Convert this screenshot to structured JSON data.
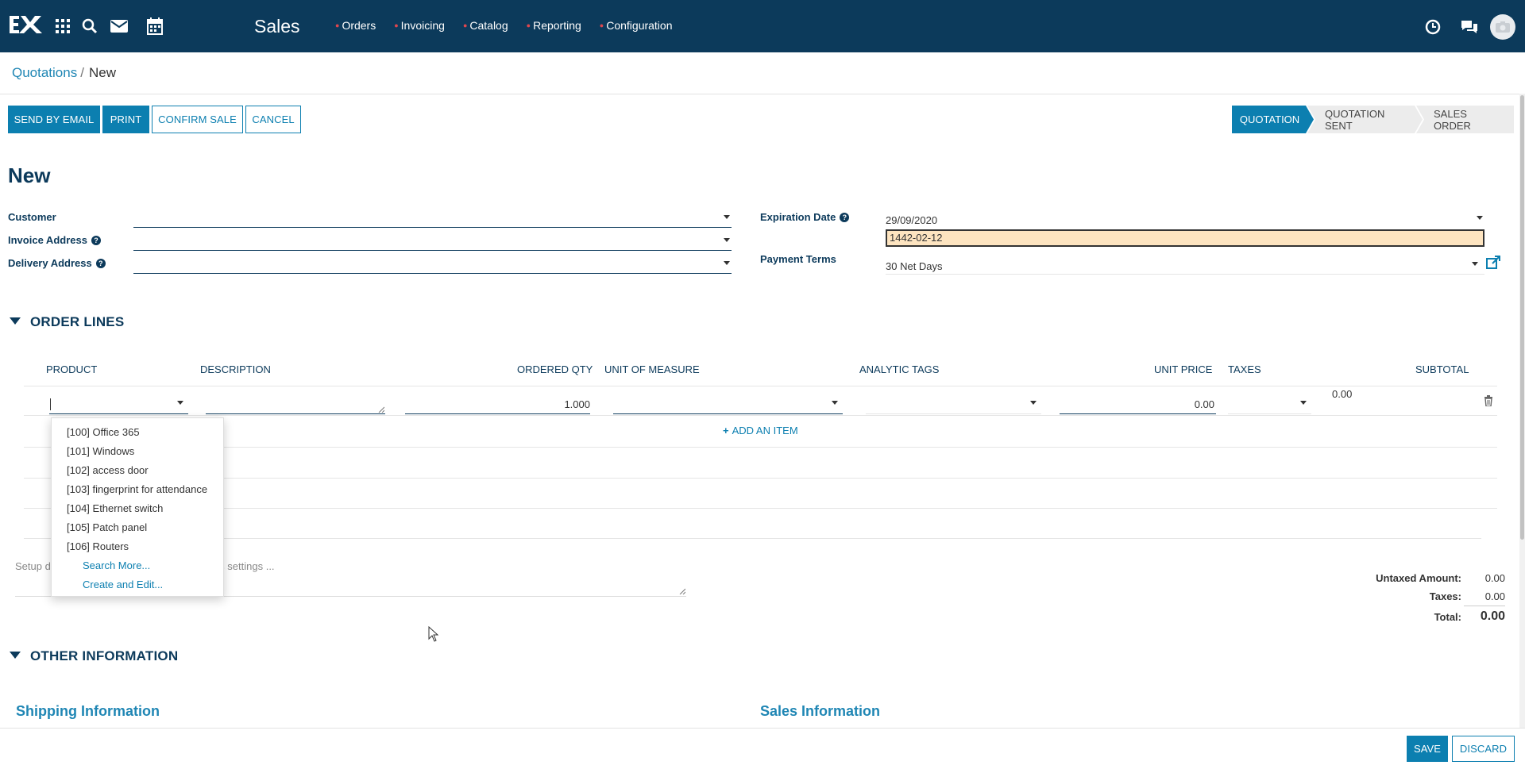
{
  "navbar": {
    "app_title": "Sales",
    "menu": [
      "Orders",
      "Invoicing",
      "Catalog",
      "Reporting",
      "Configuration"
    ]
  },
  "breadcrumb": {
    "parent": "Quotations",
    "separator": "/",
    "current": "New"
  },
  "actions": {
    "send_by_email": "SEND BY EMAIL",
    "print": "PRINT",
    "confirm_sale": "CONFIRM SALE",
    "cancel": "CANCEL"
  },
  "status": [
    "QUOTATION",
    "QUOTATION SENT",
    "SALES ORDER"
  ],
  "record_title": "New",
  "form": {
    "customer_label": "Customer",
    "invoice_address_label": "Invoice Address",
    "delivery_address_label": "Delivery Address",
    "expiration_date_label": "Expiration Date",
    "expiration_date_value": "29/09/2020",
    "expiration_date_hijri": "1442-02-12",
    "payment_terms_label": "Payment Terms",
    "payment_terms_value": "30 Net Days"
  },
  "sections": {
    "order_lines": "ORDER LINES",
    "other_information": "OTHER INFORMATION"
  },
  "table": {
    "headers": {
      "product": "PRODUCT",
      "description": "DESCRIPTION",
      "ordered_qty": "ORDERED QTY",
      "uom": "UNIT OF MEASURE",
      "analytic_tags": "ANALYTIC TAGS",
      "unit_price": "UNIT PRICE",
      "taxes": "TAXES",
      "subtotal": "SUBTOTAL"
    },
    "row": {
      "qty": "1.000",
      "unit_price": "0.00",
      "subtotal": "0.00"
    },
    "add_item": "ADD AN ITEM"
  },
  "product_dropdown": {
    "items": [
      "[100] Office 365",
      "[101] Windows",
      "[102] access door",
      "[103] fingerprint for attendance",
      "[104] Ethernet switch",
      "[105] Patch panel",
      "[106] Routers"
    ],
    "search_more": "Search More...",
    "create_edit": "Create and Edit..."
  },
  "note": {
    "hint_left": "Setup d",
    "hint_right": "ales settings ..."
  },
  "totals": {
    "untaxed_label": "Untaxed Amount:",
    "untaxed_value": "0.00",
    "taxes_label": "Taxes:",
    "taxes_value": "0.00",
    "total_label": "Total:",
    "total_value": "0.00"
  },
  "subsections": {
    "shipping": "Shipping Information",
    "sales": "Sales Information"
  },
  "bottom": {
    "save": "SAVE",
    "discard": "DISCARD"
  },
  "colors": {
    "navbar": "#0c3a5b",
    "primary": "#0c7fb0",
    "date_highlight": "#fde4c0"
  }
}
